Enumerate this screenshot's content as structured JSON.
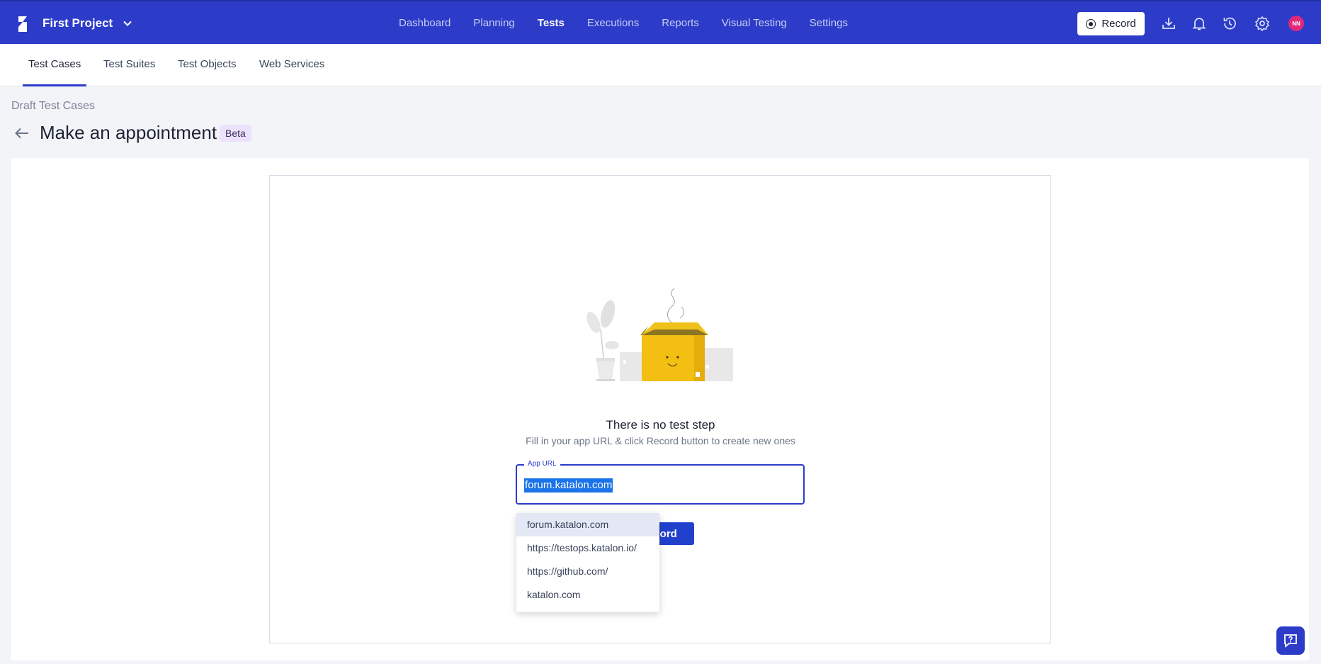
{
  "header": {
    "project_name": "First Project",
    "nav": [
      "Dashboard",
      "Planning",
      "Tests",
      "Executions",
      "Reports",
      "Visual Testing",
      "Settings"
    ],
    "active_nav": "Tests",
    "record_label": "Record",
    "avatar_initials": "NN",
    "brand_color": "#2c3cc8"
  },
  "subnav": {
    "tabs": [
      "Test Cases",
      "Test Suites",
      "Test Objects",
      "Web Services"
    ],
    "active_tab": "Test Cases"
  },
  "page": {
    "breadcrumb": "Draft Test Cases",
    "title": "Make an appointment",
    "badge": "Beta"
  },
  "empty_state": {
    "title": "There is no test step",
    "subtitle": "Fill in your app URL & click Record button to create new ones"
  },
  "url_field": {
    "label": "App URL",
    "value": "forum.katalon.com"
  },
  "record_button": {
    "label": "Record"
  },
  "suggestions": [
    "forum.katalon.com",
    "https://testops.katalon.io/",
    "https://github.com/",
    "katalon.com"
  ]
}
